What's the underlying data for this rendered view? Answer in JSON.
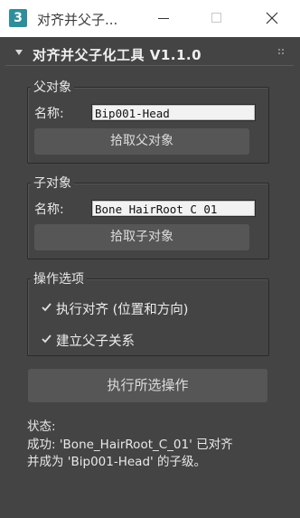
{
  "window": {
    "app_icon_text": "3",
    "title": "对齐并父子...",
    "buttons": [
      "minimize",
      "maximize",
      "close"
    ]
  },
  "rollout": {
    "title": "对齐并父子化工具 V1.1.0",
    "expanded": true
  },
  "parent_group": {
    "label": "父对象",
    "name_label": "名称:",
    "name_value": "Bip001-Head",
    "pick_button": "拾取父对象"
  },
  "child_group": {
    "label": "子对象",
    "name_label": "名称:",
    "name_value": "Bone_HairRoot_C_01",
    "pick_button": "拾取子对象"
  },
  "options_group": {
    "label": "操作选项",
    "align": {
      "label": "执行对齐 (位置和方向)",
      "checked": true
    },
    "link": {
      "label": "建立父子关系",
      "checked": true
    }
  },
  "execute_button": "执行所选操作",
  "status": {
    "label": "状态:",
    "line1": "成功: 'Bone_HairRoot_C_01' 已对齐",
    "line2": "并成为 'Bip001-Head' 的子级。"
  },
  "colors": {
    "panel_bg": "#444444",
    "titlebar_bg": "#ffffff",
    "app_icon_bg": "#2f8e9c",
    "button_bg": "#565656",
    "field_bg": "#f2f2f2"
  }
}
